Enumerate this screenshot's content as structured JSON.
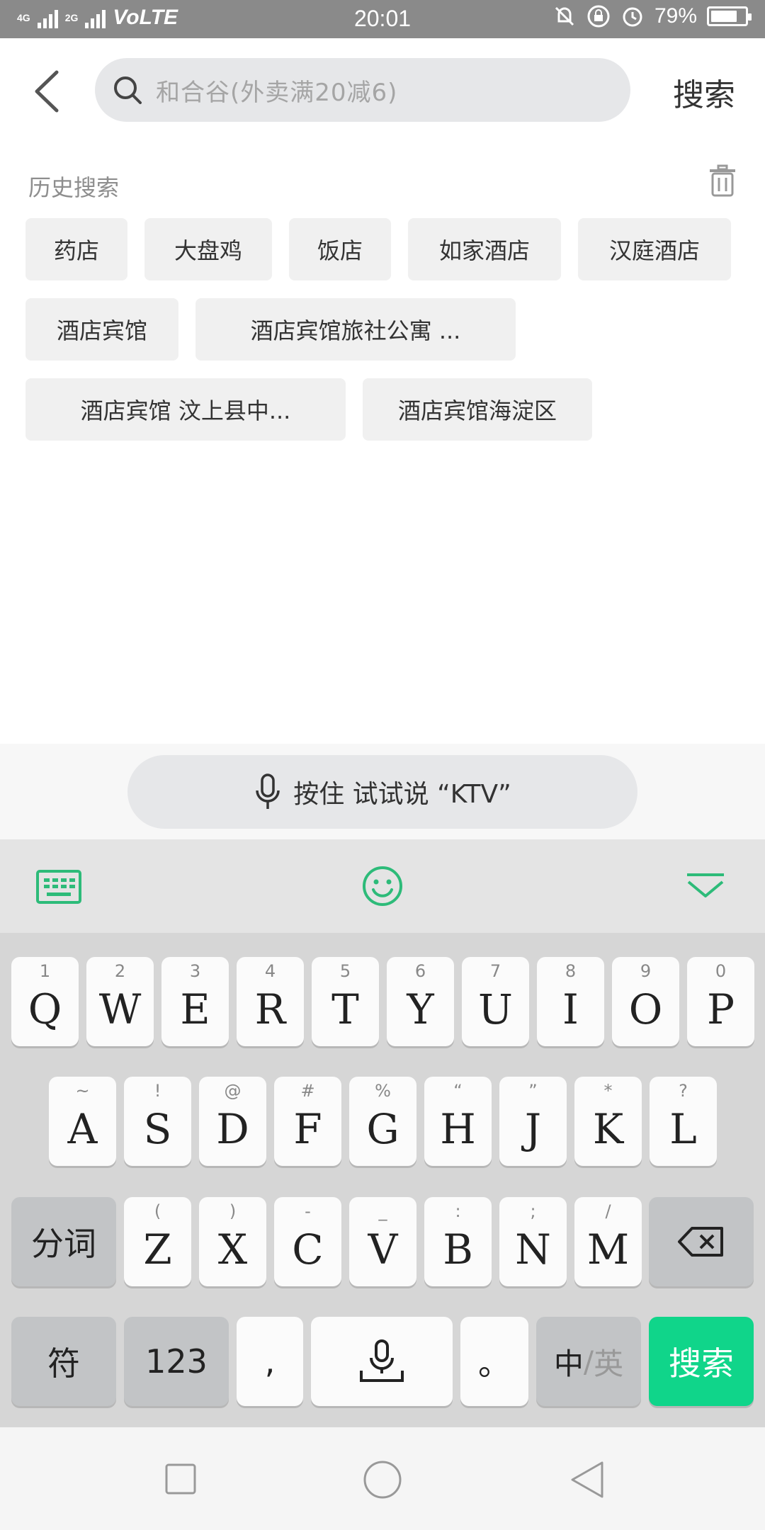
{
  "status_bar": {
    "network_left": "4G",
    "network_right": "2G",
    "volte": "VoLTE",
    "time": "20:01",
    "battery": "79%",
    "battery_level": 0.79
  },
  "header": {
    "search_placeholder": "和合谷(外卖满20减6)",
    "search_button": "搜索"
  },
  "history": {
    "title": "历史搜索",
    "items": [
      "药店",
      "大盘鸡",
      "饭店",
      "如家酒店",
      "汉庭酒店",
      "酒店宾馆",
      "酒店宾馆旅社公寓 ...",
      "酒店宾馆 汶上县中...",
      "酒店宾馆海淀区"
    ]
  },
  "voice": {
    "label": "按住 试试说 “KTV”"
  },
  "keyboard": {
    "row1": [
      {
        "hint": "1",
        "key": "Q"
      },
      {
        "hint": "2",
        "key": "W"
      },
      {
        "hint": "3",
        "key": "E"
      },
      {
        "hint": "4",
        "key": "R"
      },
      {
        "hint": "5",
        "key": "T"
      },
      {
        "hint": "6",
        "key": "Y"
      },
      {
        "hint": "7",
        "key": "U"
      },
      {
        "hint": "8",
        "key": "I"
      },
      {
        "hint": "9",
        "key": "O"
      },
      {
        "hint": "0",
        "key": "P"
      }
    ],
    "row2": [
      {
        "hint": "~",
        "key": "A"
      },
      {
        "hint": "!",
        "key": "S"
      },
      {
        "hint": "@",
        "key": "D"
      },
      {
        "hint": "#",
        "key": "F"
      },
      {
        "hint": "%",
        "key": "G"
      },
      {
        "hint": "“",
        "key": "H"
      },
      {
        "hint": "”",
        "key": "J"
      },
      {
        "hint": "*",
        "key": "K"
      },
      {
        "hint": "?",
        "key": "L"
      }
    ],
    "row3": [
      {
        "hint": "(",
        "key": "Z"
      },
      {
        "hint": ")",
        "key": "X"
      },
      {
        "hint": "-",
        "key": "C"
      },
      {
        "hint": "_",
        "key": "V"
      },
      {
        "hint": ":",
        "key": "B"
      },
      {
        "hint": ";",
        "key": "N"
      },
      {
        "hint": "/",
        "key": "M"
      }
    ],
    "segment_key": "分词",
    "symbol_key": "符",
    "num_key": "123",
    "comma_key": ",",
    "period_key": "。",
    "lang_key_cn": "中",
    "lang_key_sep": "/",
    "lang_key_en": "英",
    "enter_key": "搜索"
  },
  "colors": {
    "accent_green": "#10d58a",
    "icon_green": "#2dbb79"
  }
}
